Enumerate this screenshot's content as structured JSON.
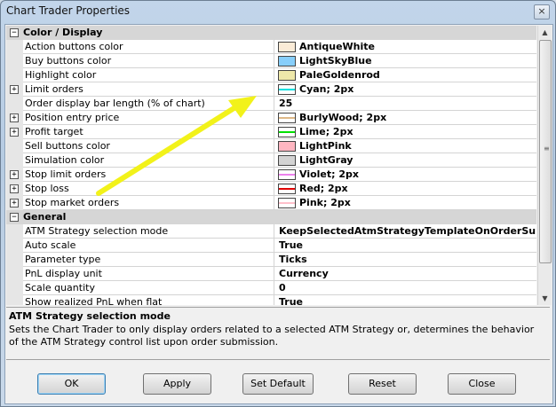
{
  "window": {
    "title": "Chart Trader Properties",
    "close_glyph": "×"
  },
  "categories": [
    {
      "label": "Color / Display",
      "expander": "−"
    },
    {
      "label": "General",
      "expander": "−"
    }
  ],
  "rows": [
    {
      "name": "Action buttons color",
      "value": "AntiqueWhite",
      "swatch_fill": "#faebd7"
    },
    {
      "name": "Buy buttons color",
      "value": "LightSkyBlue",
      "swatch_fill": "#87cefa"
    },
    {
      "name": "Highlight color",
      "value": "PaleGoldenrod",
      "swatch_fill": "#eee8aa"
    },
    {
      "name": "Limit orders",
      "value": "Cyan; 2px",
      "swatch_line": "#00e0e0",
      "expander": "+"
    },
    {
      "name": "Order display bar length (% of chart)",
      "value": "25"
    },
    {
      "name": "Position entry price",
      "value": "BurlyWood; 2px",
      "swatch_line": "#deb887",
      "expander": "+"
    },
    {
      "name": "Profit target",
      "value": "Lime; 2px",
      "swatch_line": "#00e000",
      "expander": "+"
    },
    {
      "name": "Sell buttons color",
      "value": "LightPink",
      "swatch_fill": "#ffb6c1"
    },
    {
      "name": "Simulation color",
      "value": "LightGray",
      "swatch_fill": "#d3d3d3"
    },
    {
      "name": "Stop limit orders",
      "value": "Violet; 2px",
      "swatch_line": "#ee82ee",
      "expander": "+"
    },
    {
      "name": "Stop loss",
      "value": "Red; 2px",
      "swatch_line": "#e00000",
      "expander": "+"
    },
    {
      "name": "Stop market orders",
      "value": "Pink; 2px",
      "swatch_line": "#ffc0cb",
      "expander": "+"
    },
    {
      "name": "ATM Strategy selection mode",
      "value": "KeepSelectedAtmStrategyTemplateOnOrderSubmission"
    },
    {
      "name": "Auto scale",
      "value": "True"
    },
    {
      "name": "Parameter type",
      "value": "Ticks"
    },
    {
      "name": "PnL display unit",
      "value": "Currency"
    },
    {
      "name": "Scale quantity",
      "value": "0"
    },
    {
      "name": "Show realized PnL when flat",
      "value": "True"
    }
  ],
  "help": {
    "title": "ATM Strategy selection mode",
    "description": "Sets the Chart Trader to only display orders related to a selected ATM Strategy or, determines the behavior of the ATM Strategy control list upon order submission."
  },
  "buttons": {
    "ok": "OK",
    "apply": "Apply",
    "set_default": "Set Default",
    "reset": "Reset",
    "close": "Close"
  },
  "scrollbar": {
    "up_glyph": "▲",
    "down_glyph": "▼",
    "grip_glyph": "≡"
  },
  "annotation": {
    "arrow_color": "#f2f21a"
  }
}
